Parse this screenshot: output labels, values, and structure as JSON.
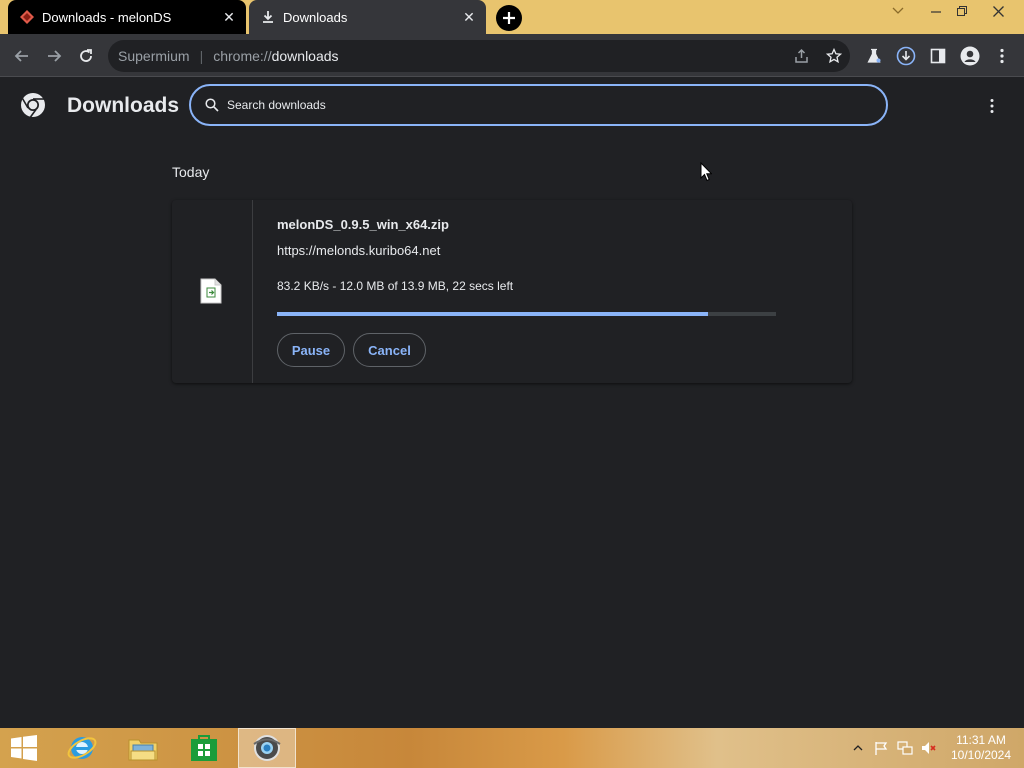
{
  "tabs": [
    {
      "title": "Downloads - melonDS",
      "icon": "melonds-icon"
    },
    {
      "title": "Downloads",
      "icon": "download-icon"
    }
  ],
  "omnibox": {
    "chip": "Supermium",
    "scheme": "chrome://",
    "host": "downloads"
  },
  "page": {
    "title": "Downloads",
    "search_placeholder": "Search downloads",
    "section_date": "Today"
  },
  "download": {
    "filename": "melonDS_0.9.5_win_x64.zip",
    "url": "https://melonds.kuribo64.net",
    "status": "83.2 KB/s - 12.0 MB of 13.9 MB, 22 secs left",
    "progress_fraction": 0.863,
    "pause_label": "Pause",
    "cancel_label": "Cancel"
  },
  "taskbar": {
    "time": "11:31 AM",
    "date": "10/10/2024",
    "apps": [
      "start-button",
      "internet-explorer-icon",
      "file-explorer-icon",
      "store-icon",
      "supermium-icon"
    ]
  },
  "colors": {
    "accent": "#8ab4f8",
    "page_bg": "#202124",
    "tabstrip_bg": "#e8c46e",
    "toolbar_bg": "#35363a"
  }
}
